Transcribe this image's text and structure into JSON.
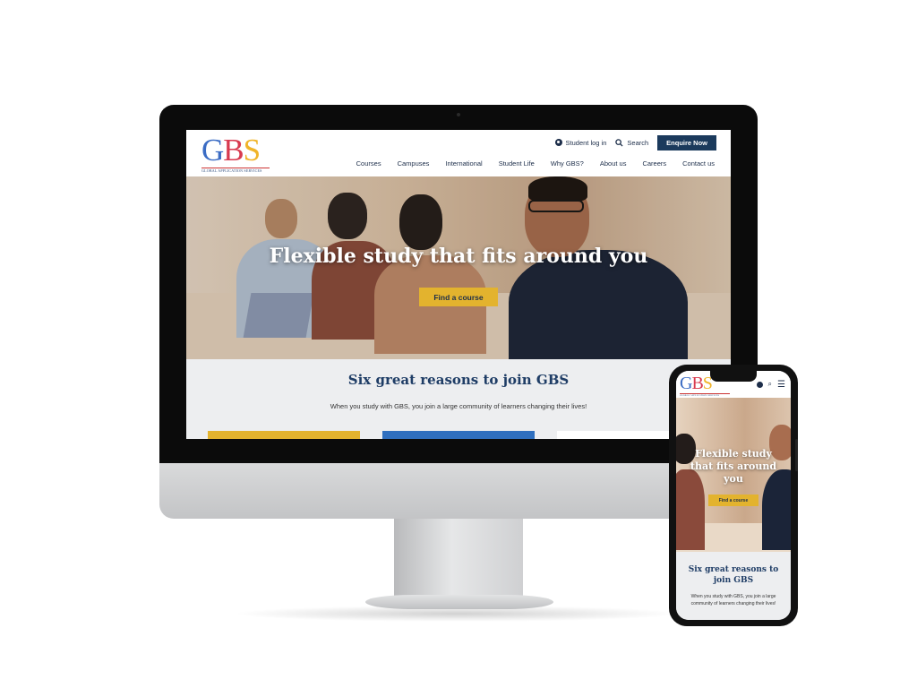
{
  "desktop": {
    "logo": {
      "letters": [
        "G",
        "B",
        "S"
      ],
      "tagline": "GLOBAL APPLICATION SERVICES"
    },
    "utility": {
      "login_label": "Student log in",
      "search_label": "Search",
      "enquire_label": "Enquire Now"
    },
    "nav": [
      "Courses",
      "Campuses",
      "International",
      "Student Life",
      "Why GBS?",
      "About us",
      "Careers",
      "Contact us"
    ],
    "hero": {
      "title": "Flexible study that fits around you",
      "button": "Find a course"
    },
    "reasons": {
      "title": "Six great reasons to join GBS",
      "subtitle": "When you study with GBS, you join a large community of learners changing their lives!"
    }
  },
  "mobile": {
    "logo": {
      "letters": [
        "G",
        "B",
        "S"
      ],
      "tagline": "GLOBAL APPLICATION SERVICES"
    },
    "hero": {
      "title": "Flexible study that fits around you",
      "button": "Find a course"
    },
    "reasons": {
      "title": "Six great reasons to join GBS",
      "subtitle": "When you study with GBS, you join a large community of learners changing their lives!"
    },
    "icons": {
      "search": "⌕",
      "menu": "☰"
    }
  },
  "colors": {
    "navy": "#1b3a5c",
    "yellow": "#e3b32e",
    "blue": "#2f6fbf",
    "logo_g": "#3b6cc4",
    "logo_b": "#d83a4f",
    "logo_s": "#f0b429"
  }
}
